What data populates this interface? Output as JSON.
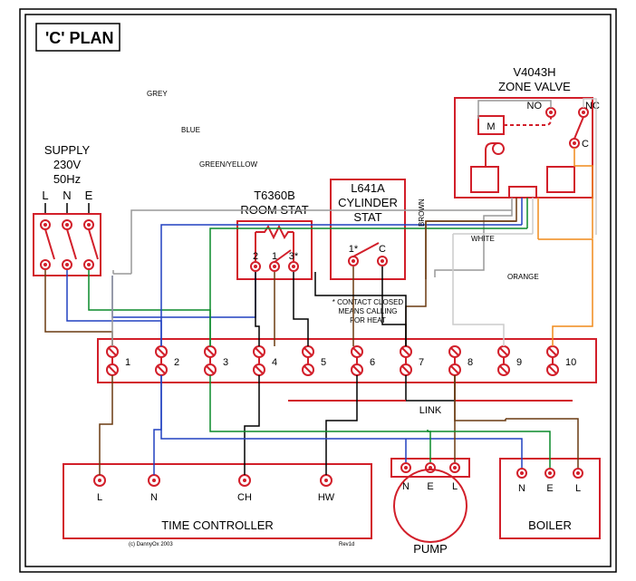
{
  "title": "'C' PLAN",
  "supply": {
    "label": "SUPPLY",
    "voltage": "230V",
    "freq": "50Hz",
    "pins": [
      "L",
      "N",
      "E"
    ]
  },
  "roomStat": {
    "model": "T6360B",
    "name": "ROOM STAT",
    "pins": [
      "2",
      "1",
      "3*"
    ]
  },
  "cylStat": {
    "model": "L641A",
    "name": "CYLINDER",
    "name2": "STAT",
    "pins": [
      "1*",
      "C"
    ],
    "note1": "* CONTACT CLOSED",
    "note2": "MEANS CALLING",
    "note3": "FOR HEAT"
  },
  "zoneValve": {
    "model": "V4043H",
    "name": "ZONE VALVE",
    "pins": {
      "no": "NO",
      "nc": "NC",
      "c": "C",
      "m": "M"
    }
  },
  "junction": {
    "terminals": [
      "1",
      "2",
      "3",
      "4",
      "5",
      "6",
      "7",
      "8",
      "9",
      "10"
    ],
    "link": "LINK"
  },
  "timeController": {
    "name": "TIME CONTROLLER",
    "pins": [
      "L",
      "N",
      "CH",
      "HW"
    ]
  },
  "pump": {
    "name": "PUMP",
    "pins": [
      "N",
      "E",
      "L"
    ]
  },
  "boiler": {
    "name": "BOILER",
    "pins": [
      "N",
      "E",
      "L"
    ]
  },
  "wireLabels": {
    "grey": "GREY",
    "blue": "BLUE",
    "green": "GREEN/YELLOW",
    "brown": "BROWN",
    "white": "WHITE",
    "orange": "ORANGE"
  },
  "credits": {
    "copy": "(c) DannyOx 2003",
    "rev": "Rev1d"
  }
}
